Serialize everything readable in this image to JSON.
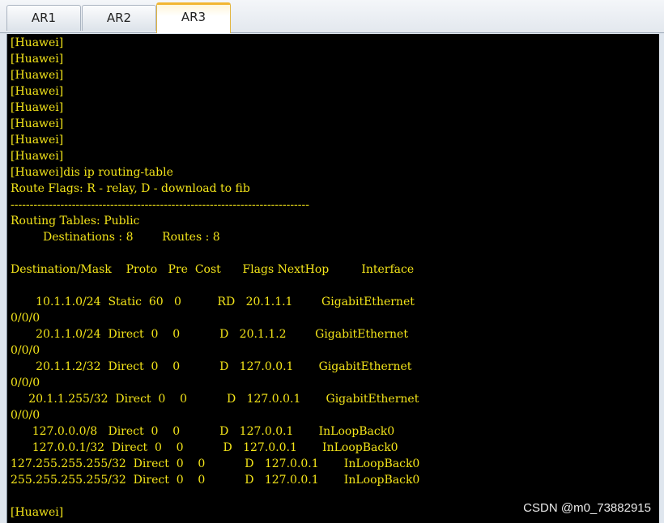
{
  "tabs": [
    {
      "label": "AR1",
      "active": false
    },
    {
      "label": "AR2",
      "active": false
    },
    {
      "label": "AR3",
      "active": true
    }
  ],
  "terminal": {
    "text_color": "#f3e419",
    "background": "#000000",
    "lines": [
      "[Huawei]",
      "[Huawei]",
      "[Huawei]",
      "[Huawei]",
      "[Huawei]",
      "[Huawei]",
      "[Huawei]",
      "[Huawei]",
      "[Huawei]dis ip routing-table",
      "Route Flags: R - relay, D - download to fib",
      "------------------------------------------------------------------------------",
      "Routing Tables: Public",
      "         Destinations : 8        Routes : 8",
      "",
      "Destination/Mask    Proto   Pre  Cost      Flags NextHop         Interface",
      "",
      "       10.1.1.0/24  Static  60   0          RD   20.1.1.1        GigabitEthernet",
      "0/0/0",
      "       20.1.1.0/24  Direct  0    0           D   20.1.1.2        GigabitEthernet",
      "0/0/0",
      "       20.1.1.2/32  Direct  0    0           D   127.0.0.1       GigabitEthernet",
      "0/0/0",
      "     20.1.1.255/32  Direct  0    0           D   127.0.0.1       GigabitEthernet",
      "0/0/0",
      "      127.0.0.0/8   Direct  0    0           D   127.0.0.1       InLoopBack0",
      "      127.0.0.1/32  Direct  0    0           D   127.0.0.1       InLoopBack0",
      "127.255.255.255/32  Direct  0    0           D   127.0.0.1       InLoopBack0",
      "255.255.255.255/32  Direct  0    0           D   127.0.0.1       InLoopBack0",
      "",
      "[Huawei]"
    ]
  },
  "watermark": "CSDN @m0_73882915"
}
